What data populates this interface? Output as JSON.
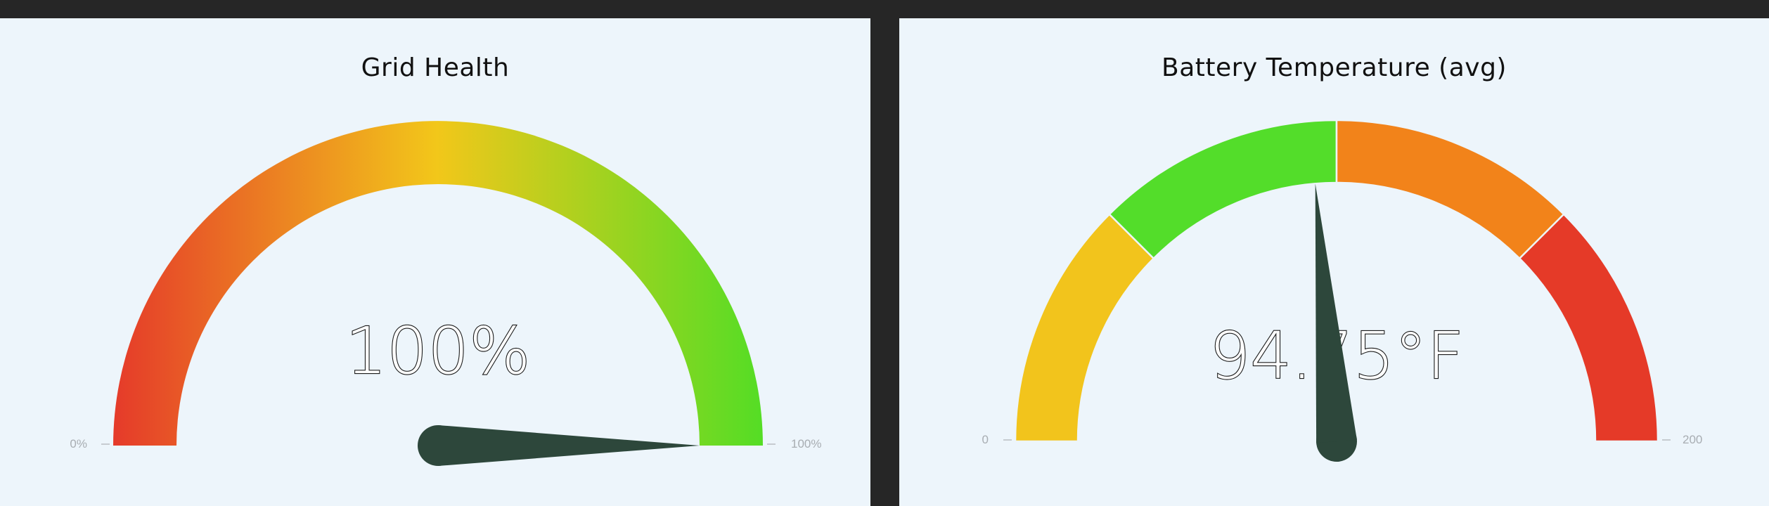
{
  "gauges": [
    {
      "title": "Grid Health",
      "value_display": "100%",
      "value": 100,
      "min": 0,
      "max": 100,
      "min_label": "0%",
      "max_label": "100%",
      "colors": {
        "low": "#e53a2a",
        "mid": "#f2c71a",
        "high": "#55dd25"
      }
    },
    {
      "title": "Battery Temperature (avg)",
      "value_display": "94.75°F",
      "value": 94.75,
      "min": 0,
      "max": 200,
      "min_label": "0",
      "max_label": "200",
      "bands": [
        {
          "from": 0,
          "to": 50,
          "color": "#f2c41c"
        },
        {
          "from": 50,
          "to": 100,
          "color": "#53dd2a"
        },
        {
          "from": 100,
          "to": 150,
          "color": "#f2831a"
        },
        {
          "from": 150,
          "to": 200,
          "color": "#e53a28"
        }
      ]
    }
  ],
  "needle_color": "#2d473b"
}
